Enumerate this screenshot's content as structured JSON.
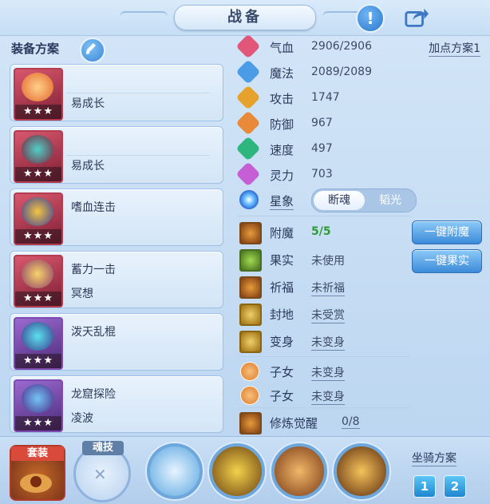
{
  "header": {
    "title": "战备"
  },
  "left": {
    "plan_title": "装备方案",
    "slots": [
      {
        "line1": "",
        "line2": "易成长",
        "stars": "★★★"
      },
      {
        "line1": "",
        "line2": "易成长",
        "stars": "★★★"
      },
      {
        "line1": "嗜血连击",
        "line2": "",
        "stars": "★★★"
      },
      {
        "line1": "蓄力一击",
        "line2": "冥想",
        "stars": "★★★"
      },
      {
        "line1": "泼天乱棍",
        "line2": "",
        "stars": "★★★"
      },
      {
        "line1": "龙窟探险",
        "line2": "凌波",
        "stars": "★★★"
      }
    ]
  },
  "stats": {
    "plan_link": "加点方案1",
    "items": [
      {
        "label": "气血",
        "value": "2906/2906",
        "color": "#e2567a"
      },
      {
        "label": "魔法",
        "value": "2089/2089",
        "color": "#4b9be6"
      },
      {
        "label": "攻击",
        "value": "1747",
        "color": "#e6a22c"
      },
      {
        "label": "防御",
        "value": "967",
        "color": "#e88a3a"
      },
      {
        "label": "速度",
        "value": "497",
        "color": "#2db77e"
      },
      {
        "label": "灵力",
        "value": "703",
        "color": "#c65fd6"
      }
    ],
    "star": {
      "label": "星象",
      "on": "断魂",
      "off": "韬光"
    }
  },
  "traits": {
    "fumo": {
      "label": "附魔",
      "value": "5/5"
    },
    "guoshi": {
      "label": "果实",
      "value": "未使用"
    },
    "qifu": {
      "label": "祈福",
      "value": "未祈福"
    },
    "fengdi": {
      "label": "封地",
      "value": "未受赏"
    },
    "bianshen": {
      "label": "变身",
      "value": "未变身"
    },
    "zinv1": {
      "label": "子女",
      "value": "未变身"
    },
    "zinv2": {
      "label": "子女",
      "value": "未变身"
    },
    "xiulian": {
      "label": "修炼觉醒",
      "value": "0/8"
    }
  },
  "buttons": {
    "fumo": "一键附魔",
    "guoshi": "一键果实"
  },
  "bottom": {
    "suit": "套装",
    "soul": "魂技",
    "mount_title": "坐骑方案",
    "mount1": "1",
    "mount2": "2"
  }
}
